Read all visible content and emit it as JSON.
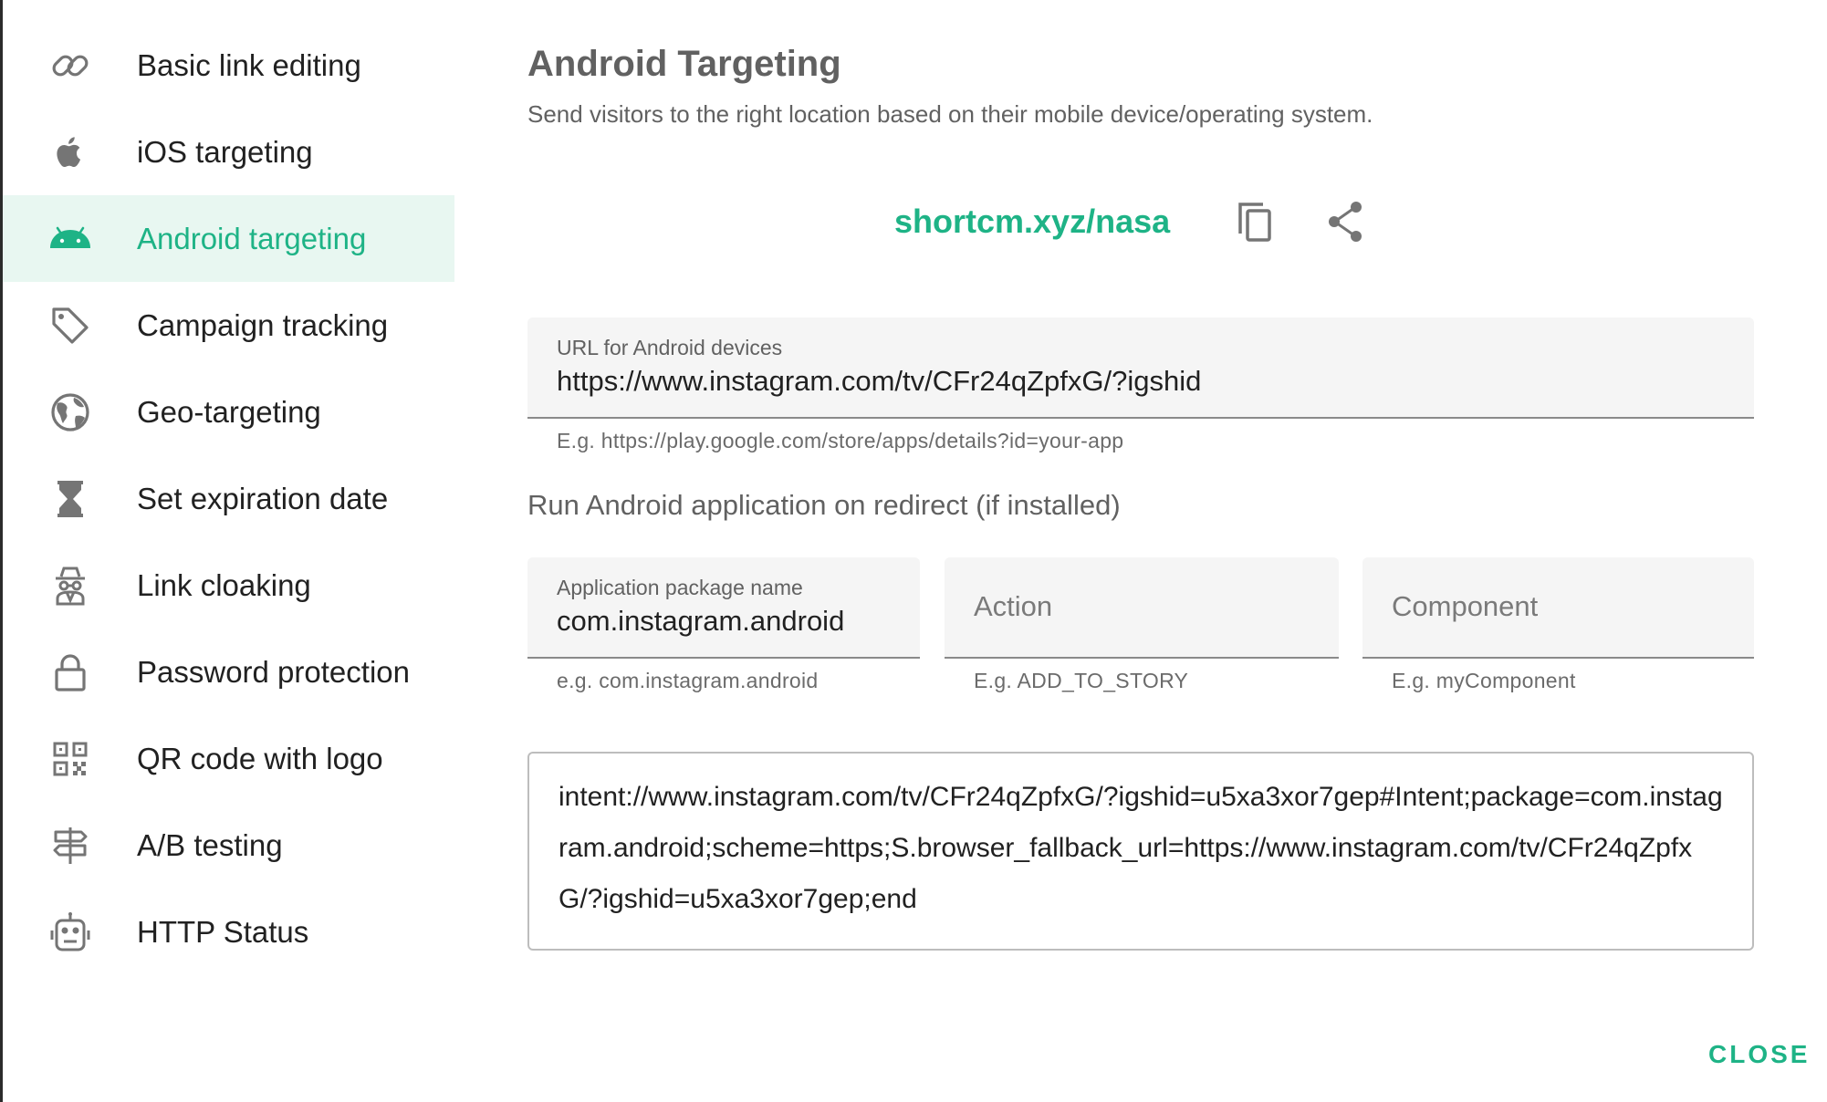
{
  "sidebar": {
    "items": [
      {
        "label": "Basic link editing",
        "icon": "link-icon"
      },
      {
        "label": "iOS targeting",
        "icon": "apple-icon"
      },
      {
        "label": "Android targeting",
        "icon": "android-icon",
        "active": true
      },
      {
        "label": "Campaign tracking",
        "icon": "tag-icon"
      },
      {
        "label": "Geo-targeting",
        "icon": "globe-icon"
      },
      {
        "label": "Set expiration date",
        "icon": "hourglass-icon"
      },
      {
        "label": "Link cloaking",
        "icon": "incognito-icon"
      },
      {
        "label": "Password protection",
        "icon": "lock-icon"
      },
      {
        "label": "QR code with logo",
        "icon": "qr-code-icon"
      },
      {
        "label": "A/B testing",
        "icon": "signpost-icon"
      },
      {
        "label": "HTTP Status",
        "icon": "robot-icon"
      }
    ]
  },
  "main": {
    "title": "Android Targeting",
    "subtitle": "Send visitors to the right location based on their mobile device/operating system.",
    "short_link": "shortcm.xyz/nasa",
    "url_field": {
      "label": "URL for Android devices",
      "value": "https://www.instagram.com/tv/CFr24qZpfxG/?igshid",
      "hint": "E.g. https://play.google.com/store/apps/details?id=your-app"
    },
    "app_section_heading": "Run Android application on redirect (if installed)",
    "package_field": {
      "label": "Application package name",
      "value": "com.instagram.android",
      "hint": "e.g. com.instagram.android"
    },
    "action_field": {
      "placeholder": "Action",
      "hint": "E.g. ADD_TO_STORY"
    },
    "component_field": {
      "placeholder": "Component",
      "hint": "E.g. myComponent"
    },
    "intent_url": "intent://www.instagram.com/tv/CFr24qZpfxG/?igshid=u5xa3xor7gep#Intent;package=com.instagram.android;scheme=https;S.browser_fallback_url=https://www.instagram.com/tv/CFr24qZpfxG/?igshid=u5xa3xor7gep;end"
  },
  "footer": {
    "close_label": "CLOSE"
  },
  "colors": {
    "accent": "#1eb386",
    "active_bg": "#e8f7f1",
    "icon_gray": "#757575"
  }
}
